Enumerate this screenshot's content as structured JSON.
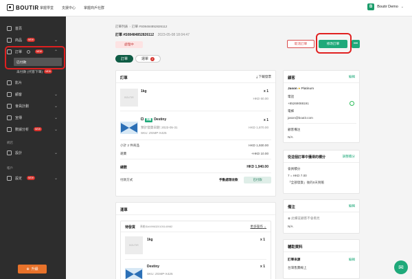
{
  "topbar": {
    "logo": "BOUTIR",
    "nav": [
      "掌握學堂",
      "支援中心",
      "掌握商戶社群"
    ],
    "store_name": "Boutir Demo",
    "store_initial": "B"
  },
  "sidebar": {
    "items": [
      {
        "label": "首頁"
      },
      {
        "label": "商品",
        "badge": "NEW"
      },
      {
        "label": "訂單",
        "badge": "NEW"
      },
      {
        "label": "影片"
      },
      {
        "label": "顧客"
      },
      {
        "label": "會員計劃"
      },
      {
        "label": "宣傳"
      },
      {
        "label": "數據分析",
        "badge": "NEW"
      },
      {
        "label": "設計"
      },
      {
        "label": "設定",
        "badge": "NEW"
      }
    ],
    "sub_items": [
      {
        "label": "已付款"
      },
      {
        "label": "未付款 (代客下單)",
        "badge": "NEW"
      }
    ],
    "sections": {
      "store": "網店",
      "account": "帳戶"
    },
    "upgrade_label": "升級"
  },
  "header": {
    "breadcrumb": [
      "訂單列表",
      "訂單 #S08484852826112"
    ],
    "order_label": "訂單 #S08484852826112",
    "order_date": "2023-05-08 18:04:47",
    "status": "處理中",
    "cancel_label": "取消訂單",
    "edit_label": "修改訂單",
    "more_label": "•••"
  },
  "tabs": [
    {
      "label": "訂單",
      "active": true
    },
    {
      "label": "運單",
      "count": "2",
      "active": false
    }
  ],
  "order_card": {
    "title": "訂單",
    "download_label": "下載發票",
    "items": [
      {
        "name": "1kg",
        "qty": "x 1",
        "price": "HKD 60.00"
      },
      {
        "name": "Destiny",
        "tag": "預購",
        "qty": "x 1",
        "price": "HKD 1,870.00",
        "ship_date": "預計發貨日期: 2023-05-31",
        "sku": "SKU: ZGMP-X425"
      }
    ],
    "subtotal_label": "小計 2 件商品",
    "subtotal_value": "HKD 1,930.00",
    "shipping_label": "運費",
    "shipping_value": "+HKD 10.00",
    "total_label": "總數",
    "total_value": "HKD 1,940.00",
    "payment_label": "付款方式",
    "payment_method": "手動處理收款",
    "paid_label": "已付款"
  },
  "shipment_card": {
    "title": "運單",
    "status": "待發貨",
    "shipment_id": "系統ID#4996320105140982",
    "actions_label": "更多操作",
    "items": [
      {
        "name": "1kg",
        "qty": "x 1"
      },
      {
        "name": "Destiny",
        "qty": "x 1",
        "sku": "SKU: ZGMP-X425"
      }
    ]
  },
  "customer_card": {
    "title": "顧客",
    "edit_label": "編輯",
    "name": "Jason",
    "tier": "Platinum",
    "phone_label": "電話",
    "phone": "+85269088191",
    "email_label": "電郵",
    "email": "jason@boutir.com",
    "remark_label": "顧客備注",
    "remark": "N/A"
  },
  "points_card": {
    "title": "從這個訂單中獲得的積分",
    "adjust_label": "調整積分",
    "points_label": "會員積分",
    "points_value": "7 = HKD 7.00",
    "points_note": "「全部發貨」後的0天到帳"
  },
  "notes_card": {
    "title": "備注",
    "edit_label": "編輯",
    "visibility": "此備註顧客不會看見",
    "value": "N/A"
  },
  "extra_card": {
    "title": "輔助資料",
    "source_label": "訂單來源",
    "edit_label": "編輯",
    "source_value": "台灣售賣線上"
  }
}
